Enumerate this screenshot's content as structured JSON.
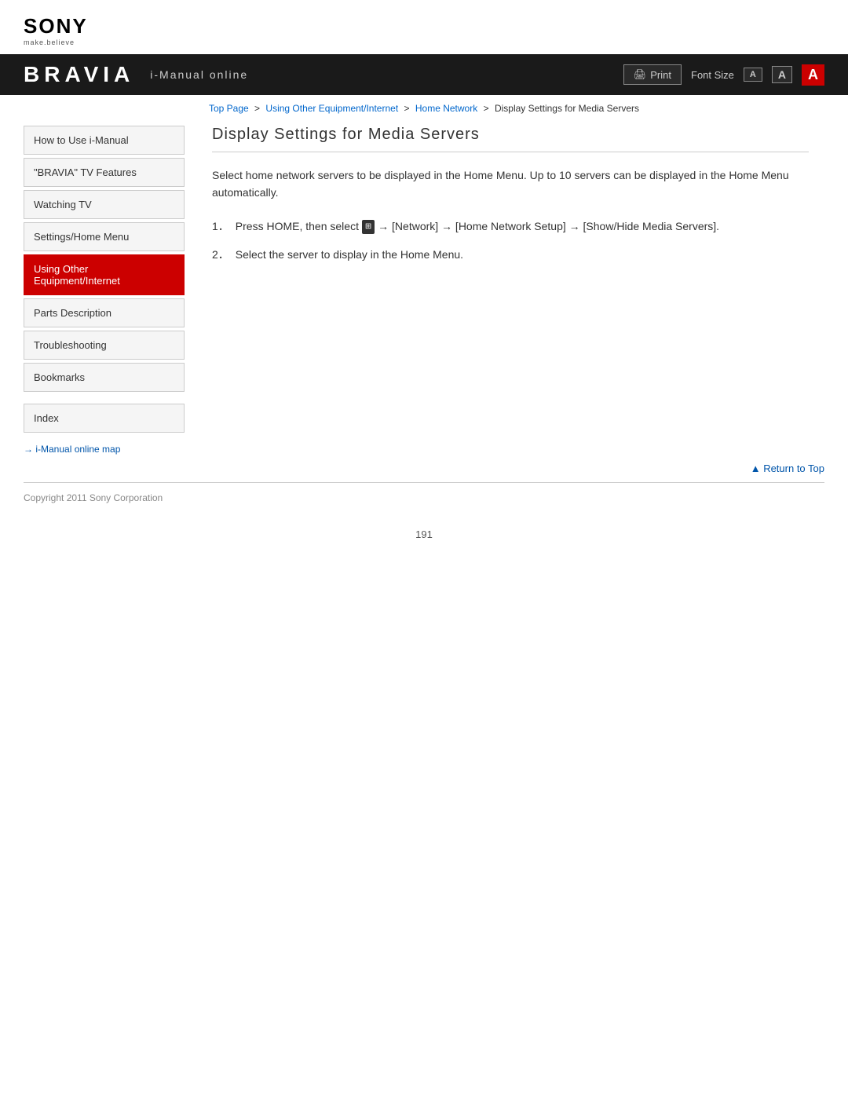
{
  "logo": {
    "brand": "SONY",
    "tagline": "make.believe"
  },
  "header": {
    "bravia": "BRAVIA",
    "subtitle": "i-Manual online",
    "print_label": "Print",
    "font_size_label": "Font Size",
    "font_small": "A",
    "font_medium": "A",
    "font_large": "A"
  },
  "breadcrumb": {
    "top_page": "Top Page",
    "sep1": ">",
    "using_other": "Using Other Equipment/Internet",
    "sep2": ">",
    "home_network": "Home Network",
    "sep3": ">",
    "current": "Display Settings for Media Servers"
  },
  "sidebar": {
    "items": [
      {
        "id": "how-to-use",
        "label": "How to Use i-Manual"
      },
      {
        "id": "bravia-features",
        "label": "\"BRAVIA\" TV Features"
      },
      {
        "id": "watching-tv",
        "label": "Watching TV"
      },
      {
        "id": "settings-home",
        "label": "Settings/Home Menu"
      },
      {
        "id": "using-other",
        "label": "Using Other Equipment/Internet",
        "active": true
      },
      {
        "id": "parts-desc",
        "label": "Parts Description"
      },
      {
        "id": "troubleshooting",
        "label": "Troubleshooting"
      },
      {
        "id": "bookmarks",
        "label": "Bookmarks"
      }
    ],
    "index_label": "Index",
    "map_link": "i-Manual online map"
  },
  "main": {
    "page_title": "Display Settings for Media Servers",
    "intro": "Select home network servers to be displayed in the Home Menu. Up to 10 servers can be displayed in the Home Menu automatically.",
    "steps": [
      {
        "num": "1．",
        "text": "Press HOME, then select",
        "icon": "⊞",
        "text2": "→ [Network] → [Home Network Setup] → [Show/Hide Media Servers]."
      },
      {
        "num": "2．",
        "text": "Select the server to display in the Home Menu."
      }
    ]
  },
  "footer": {
    "return_top": "Return to Top",
    "copyright": "Copyright 2011 Sony Corporation",
    "page_number": "191"
  }
}
